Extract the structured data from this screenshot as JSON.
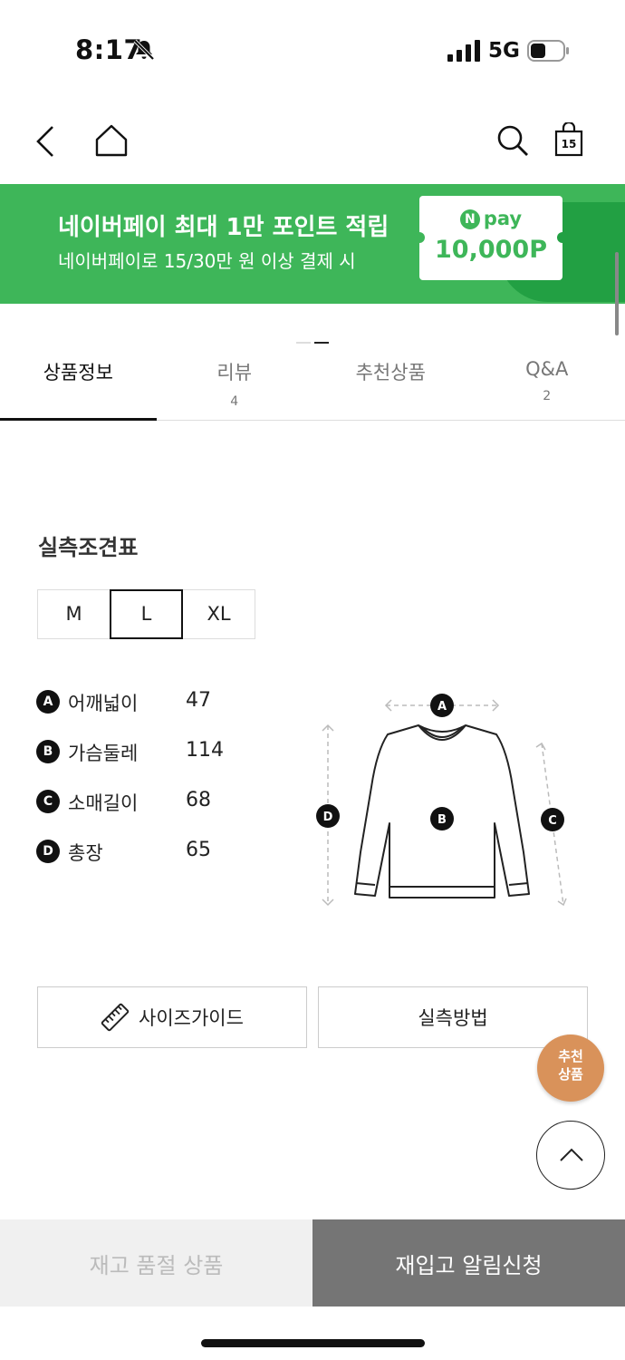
{
  "status_bar": {
    "time": "8:17",
    "network": "5G",
    "icons": [
      "bell-muted-icon",
      "signal-icon",
      "battery-icon"
    ]
  },
  "nav": {
    "cart_count": "15",
    "icons": [
      "chevron-left-icon",
      "home-icon",
      "search-icon",
      "shopping-bag-icon"
    ]
  },
  "banner": {
    "title": "네이버페이 최대 1만 포인트 적립",
    "subtitle": "네이버페이로 15/30만 원 이상 결제 시",
    "badge_n": "N",
    "badge_pay": "pay",
    "amount": "10,000P",
    "colors": {
      "green": "#3eb659",
      "dark_green": "#22a043"
    }
  },
  "tabs": [
    {
      "label": "상품정보",
      "count": ""
    },
    {
      "label": "리뷰",
      "count": "4"
    },
    {
      "label": "추천상품",
      "count": ""
    },
    {
      "label": "Q&A",
      "count": "2"
    }
  ],
  "size_chart": {
    "title": "실측조견표",
    "sizes": [
      "M",
      "L",
      "XL"
    ],
    "selected_size": "L",
    "measurements": [
      {
        "key": "A",
        "label": "어깨넓이",
        "value": "47"
      },
      {
        "key": "B",
        "label": "가슴둘레",
        "value": "114"
      },
      {
        "key": "C",
        "label": "소매길이",
        "value": "68"
      },
      {
        "key": "D",
        "label": "총장",
        "value": "65"
      }
    ],
    "diagram_labels": [
      "A",
      "B",
      "C",
      "D"
    ]
  },
  "buttons": {
    "size_guide": "사이즈가이드",
    "measure_method": "실측방법"
  },
  "floating": {
    "recommend_line1": "추천",
    "recommend_line2": "상품",
    "recommend_color": "#d9925a"
  },
  "bottom_bar": {
    "sold_out": "재고 품절 상품",
    "restock_alert": "재입고 알림신청"
  }
}
